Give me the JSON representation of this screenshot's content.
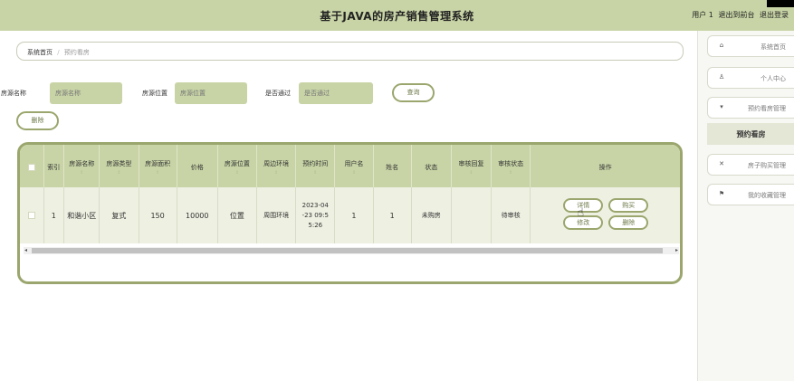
{
  "app": {
    "title": "基于JAVA的房产销售管理系统",
    "user_label": "用户 1",
    "back_to_front": "退出到前台",
    "logout": "退出登录"
  },
  "breadcrumb": {
    "home": "系统首页",
    "separator": "/",
    "current": "预约看房"
  },
  "search": {
    "name_label": "房源名称",
    "name_placeholder": "房源名称",
    "location_label": "房源位置",
    "location_placeholder": "房源位置",
    "passed_label": "是否通过",
    "passed_placeholder": "是否通过",
    "query_button": "查询"
  },
  "actions": {
    "delete_button": "删除"
  },
  "table": {
    "headers": {
      "index": "索引",
      "house_name": "房源名称",
      "house_type": "房源类型",
      "house_area": "房源面积",
      "price": "价格",
      "house_location": "房源位置",
      "surroundings": "周边环境",
      "appointment_time": "预约时间",
      "username": "用户名",
      "name": "姓名",
      "status": "状态",
      "review_reply": "审核回复",
      "review_status": "审核状态",
      "operation": "操作"
    },
    "sort_glyph": "⇕",
    "rows": [
      {
        "index": "1",
        "house_name": "和谐小区",
        "house_type": "复式",
        "house_area": "150",
        "price": "10000",
        "house_location": "位置",
        "surroundings": "周围环境",
        "appointment_time_l1": "2023-04",
        "appointment_time_l2": "-23 09:5",
        "appointment_time_l3": "5:26",
        "username": "1",
        "name": "1",
        "status": "未购房",
        "review_reply": "",
        "review_status": "待审核",
        "btn_detail": "详情",
        "btn_buy": "购买",
        "btn_edit": "修改",
        "btn_delete": "删除"
      }
    ]
  },
  "sidebar": {
    "items": [
      {
        "label": "系统首页",
        "icon": "home-icon",
        "glyph": "⌂"
      },
      {
        "label": "个人中心",
        "icon": "user-icon",
        "glyph": "♙"
      },
      {
        "label": "预约看房管理",
        "icon": "calendar-icon",
        "glyph": "▾"
      },
      {
        "label": "房子购买管理",
        "icon": "cart-icon",
        "glyph": "✕"
      },
      {
        "label": "我的收藏管理",
        "icon": "flag-icon",
        "glyph": "⚑"
      }
    ],
    "active_sub": "预约看房"
  },
  "colors": {
    "accent": "#c8d4a6",
    "border_accent": "#9aa66d",
    "row_bg": "#eef0e2"
  }
}
